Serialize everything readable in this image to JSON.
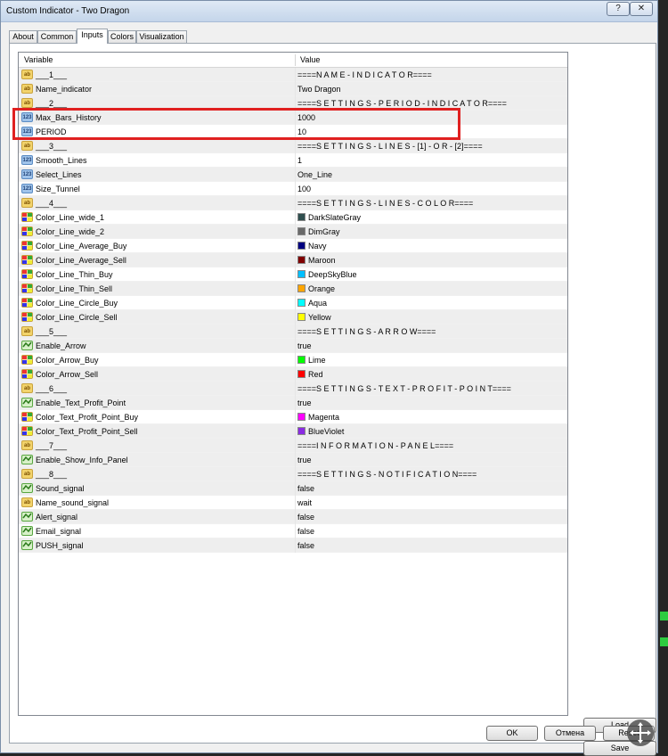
{
  "window": {
    "title": "Custom Indicator - Two Dragon",
    "help_label": "?",
    "close_label": "✕"
  },
  "tabs": [
    {
      "label": "About",
      "active": false
    },
    {
      "label": "Common",
      "active": false
    },
    {
      "label": "Inputs",
      "active": true
    },
    {
      "label": "Colors",
      "active": false
    },
    {
      "label": "Visualization",
      "active": false
    }
  ],
  "table": {
    "headers": {
      "variable": "Variable",
      "value": "Value"
    },
    "rows": [
      {
        "type": "ab",
        "name": "___1___",
        "value": "====N A M E - I N D I C A T O R===="
      },
      {
        "type": "ab",
        "name": "Name_indicator",
        "value": "Two Dragon"
      },
      {
        "type": "ab",
        "name": "___2___",
        "value": "====S E T T I N G S - P E R I O D - I N D I C A T O R===="
      },
      {
        "type": "num",
        "name": "Max_Bars_History",
        "value": "1000"
      },
      {
        "type": "num",
        "name": "PERIOD",
        "value": "10"
      },
      {
        "type": "ab",
        "name": "___3___",
        "value": "====S E T T I N G S - L I N E S - [1] - O R - [2]===="
      },
      {
        "type": "num",
        "name": "Smooth_Lines",
        "value": "1"
      },
      {
        "type": "num",
        "name": "Select_Lines",
        "value": "One_Line"
      },
      {
        "type": "num",
        "name": "Size_Tunnel",
        "value": "100"
      },
      {
        "type": "ab",
        "name": "___4___",
        "value": "====S E T T I N G S - L I N E S - C O L O R===="
      },
      {
        "type": "clr",
        "name": "Color_Line_wide_1",
        "value": "DarkSlateGray",
        "color": "#2f4f4f"
      },
      {
        "type": "clr",
        "name": "Color_Line_wide_2",
        "value": "DimGray",
        "color": "#696969"
      },
      {
        "type": "clr",
        "name": "Color_Line_Average_Buy",
        "value": "Navy",
        "color": "#000080"
      },
      {
        "type": "clr",
        "name": "Color_Line_Average_Sell",
        "value": "Maroon",
        "color": "#800000"
      },
      {
        "type": "clr",
        "name": "Color_Line_Thin_Buy",
        "value": "DeepSkyBlue",
        "color": "#00bfff"
      },
      {
        "type": "clr",
        "name": "Color_Line_Thin_Sell",
        "value": "Orange",
        "color": "#ffa500"
      },
      {
        "type": "clr",
        "name": "Color_Line_Circle_Buy",
        "value": "Aqua",
        "color": "#00ffff"
      },
      {
        "type": "clr",
        "name": "Color_Line_Circle_Sell",
        "value": "Yellow",
        "color": "#ffff00"
      },
      {
        "type": "ab",
        "name": "___5___",
        "value": "====S E T T I N G S - A R R O W===="
      },
      {
        "type": "bool",
        "name": "Enable_Arrow",
        "value": "true"
      },
      {
        "type": "clr",
        "name": "Color_Arrow_Buy",
        "value": "Lime",
        "color": "#00ff00"
      },
      {
        "type": "clr",
        "name": "Color_Arrow_Sell",
        "value": "Red",
        "color": "#ff0000"
      },
      {
        "type": "ab",
        "name": "___6___",
        "value": "====S E T T I N G S - T E X T - P R O F I T - P O I N T===="
      },
      {
        "type": "bool",
        "name": "Enable_Text_Profit_Point",
        "value": "true"
      },
      {
        "type": "clr",
        "name": "Color_Text_Profit_Point_Buy",
        "value": "Magenta",
        "color": "#ff00ff"
      },
      {
        "type": "clr",
        "name": "Color_Text_Profit_Point_Sell",
        "value": "BlueViolet",
        "color": "#8a2be2"
      },
      {
        "type": "ab",
        "name": "___7___",
        "value": "====I N F O R M A T I O N - P A N E L===="
      },
      {
        "type": "bool",
        "name": "Enable_Show_Info_Panel",
        "value": "true"
      },
      {
        "type": "ab",
        "name": "___8___",
        "value": "====S E T T I N G S - N O T I F I C A T I O N===="
      },
      {
        "type": "bool",
        "name": "Sound_signal",
        "value": "false"
      },
      {
        "type": "ab",
        "name": "Name_sound_signal",
        "value": "wait"
      },
      {
        "type": "bool",
        "name": "Alert_signal",
        "value": "false"
      },
      {
        "type": "bool",
        "name": "Email_signal",
        "value": "false"
      },
      {
        "type": "bool",
        "name": "PUSH_signal",
        "value": "false"
      }
    ]
  },
  "buttons": {
    "load": "Load",
    "save": "Save",
    "ok": "OK",
    "cancel": "Отмена",
    "reset": "Reset"
  },
  "colors": {
    "highlight": "#e02020",
    "window_bg": "#f0f0f0"
  },
  "icons": {
    "string": "ab-icon",
    "number": "123-icon",
    "color": "palette-icon",
    "bool": "bool-icon"
  }
}
